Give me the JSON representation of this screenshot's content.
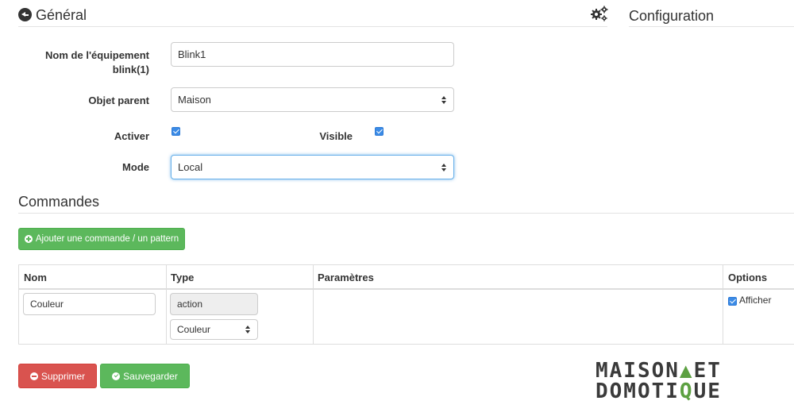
{
  "general": {
    "title": "Général"
  },
  "configuration": {
    "title": "Configuration"
  },
  "form": {
    "name_label_line1": "Nom de l'équipement",
    "name_label_line2": "blink(1)",
    "name_value": "Blink1",
    "parent_label": "Objet parent",
    "parent_value": "Maison",
    "enable_label": "Activer",
    "enable_checked": true,
    "visible_label": "Visible",
    "visible_checked": true,
    "mode_label": "Mode",
    "mode_value": "Local"
  },
  "commands": {
    "title": "Commandes",
    "add_button": "Ajouter une commande / un pattern",
    "columns": {
      "name": "Nom",
      "type": "Type",
      "params": "Paramètres",
      "options": "Options"
    },
    "rows": [
      {
        "name": "Couleur",
        "type": "action",
        "subtype": "Couleur",
        "option_label": "Afficher",
        "option_checked": true
      }
    ]
  },
  "actions": {
    "delete": "Supprimer",
    "save": "Sauvegarder"
  },
  "logo": {
    "line1_a": "MAISON",
    "line1_b": "ET",
    "line2_a": "DOMOTI",
    "line2_b": "Q",
    "line2_c": "UE"
  },
  "colors": {
    "primary_green": "#5cb85c",
    "danger_red": "#d9534f",
    "checkbox_blue": "#3b8be6",
    "logo_green": "#5ca041"
  },
  "icons": {
    "back": "circle-arrow-left-icon",
    "config": "gears-icon",
    "add": "plus-circle-icon",
    "delete": "minus-circle-icon",
    "save": "check-circle-icon"
  }
}
